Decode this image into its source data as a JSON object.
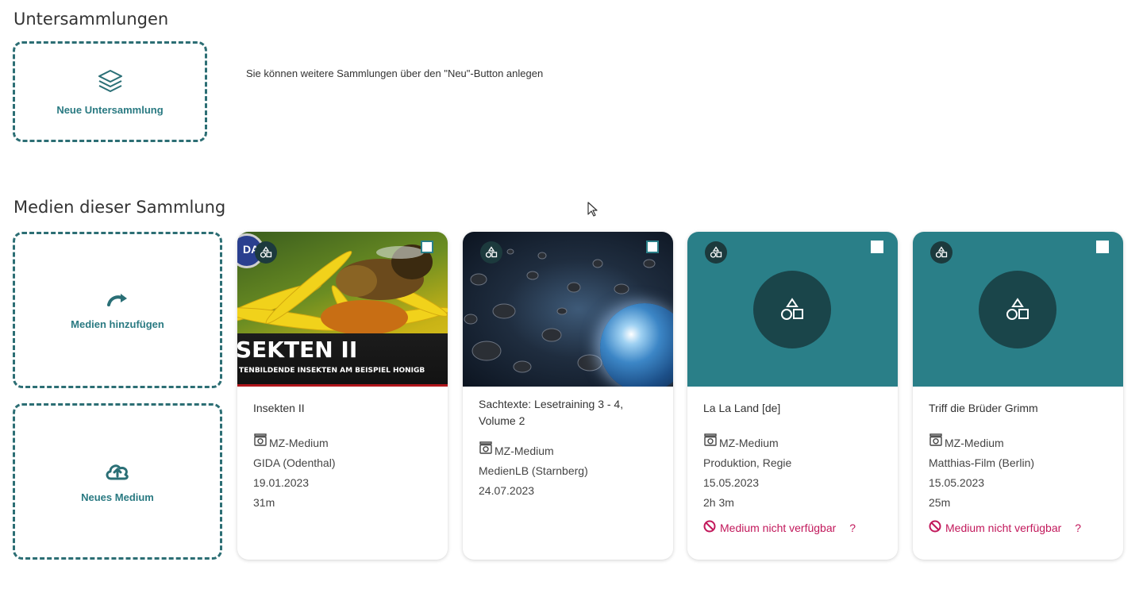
{
  "sections": {
    "subcollections_title": "Untersammlungen",
    "media_title": "Medien dieser Sammlung"
  },
  "new_subcollection": {
    "label": "Neue Untersammlung",
    "icon": "layers-icon"
  },
  "hint_text": "Sie können weitere Sammlungen über den \"Neu\"-Button anlegen",
  "add_media": {
    "label": "Medien hinzufügen",
    "icon": "redo-arrow-icon"
  },
  "new_medium": {
    "label": "Neues Medium",
    "icon": "cloud-upload-icon"
  },
  "accent_color": "#2a7f88",
  "unavailable_color": "#c2185b",
  "cards": [
    {
      "title": "Insekten II",
      "type": "MZ-Medium",
      "provider": "GIDA (Odenthal)",
      "date": "19.01.2023",
      "duration": "31m",
      "thumb_text_big": "SEKTEN II",
      "thumb_text_small": "TENBILDENDE INSEKTEN AM BEISPIEL HONIGB",
      "thumb_logo_text": "DA"
    },
    {
      "title": "Sachtexte: Lesetraining 3 - 4, Volume 2",
      "type": "MZ-Medium",
      "provider": "MedienLB (Starnberg)",
      "date": "24.07.2023"
    },
    {
      "title": "La La Land [de]",
      "type": "MZ-Medium",
      "provider": "Produktion, Regie",
      "date": "15.05.2023",
      "duration": "2h 3m",
      "unavailable": "Medium nicht verfügbar",
      "help": "?"
    },
    {
      "title": "Triff die Brüder Grimm",
      "type": "MZ-Medium",
      "provider": "Matthias-Film (Berlin)",
      "date": "15.05.2023",
      "duration": "25m",
      "unavailable": "Medium nicht verfügbar",
      "help": "?"
    }
  ]
}
